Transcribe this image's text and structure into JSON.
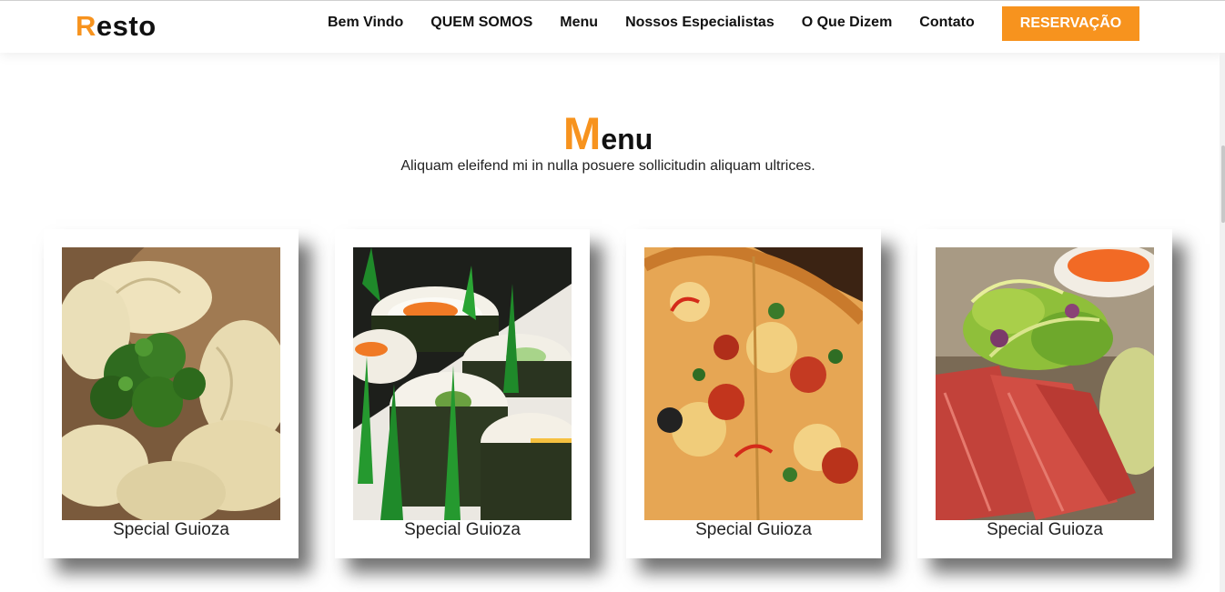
{
  "brand": {
    "first_letter": "R",
    "rest": "esto"
  },
  "nav": {
    "links": [
      "Bem Vindo",
      "QUEM SOMOS",
      "Menu",
      "Nossos Especialistas",
      "O Que Dizem",
      "Contato"
    ],
    "reserve_label": "RESERVAÇÃO"
  },
  "menu_section": {
    "title_first": "M",
    "title_rest": "enu",
    "subtitle": "Aliquam eleifend mi in nulla posuere sollicitudin aliquam ultrices."
  },
  "cards": [
    {
      "caption": "Special Guioza",
      "photo": "dumplings-photo"
    },
    {
      "caption": "Special Guioza",
      "photo": "sushi-photo"
    },
    {
      "caption": "Special Guioza",
      "photo": "pizza-photo"
    },
    {
      "caption": "Special Guioza",
      "photo": "tuna-salad-photo"
    }
  ],
  "colors": {
    "accent": "#f7931e",
    "text": "#111111"
  }
}
